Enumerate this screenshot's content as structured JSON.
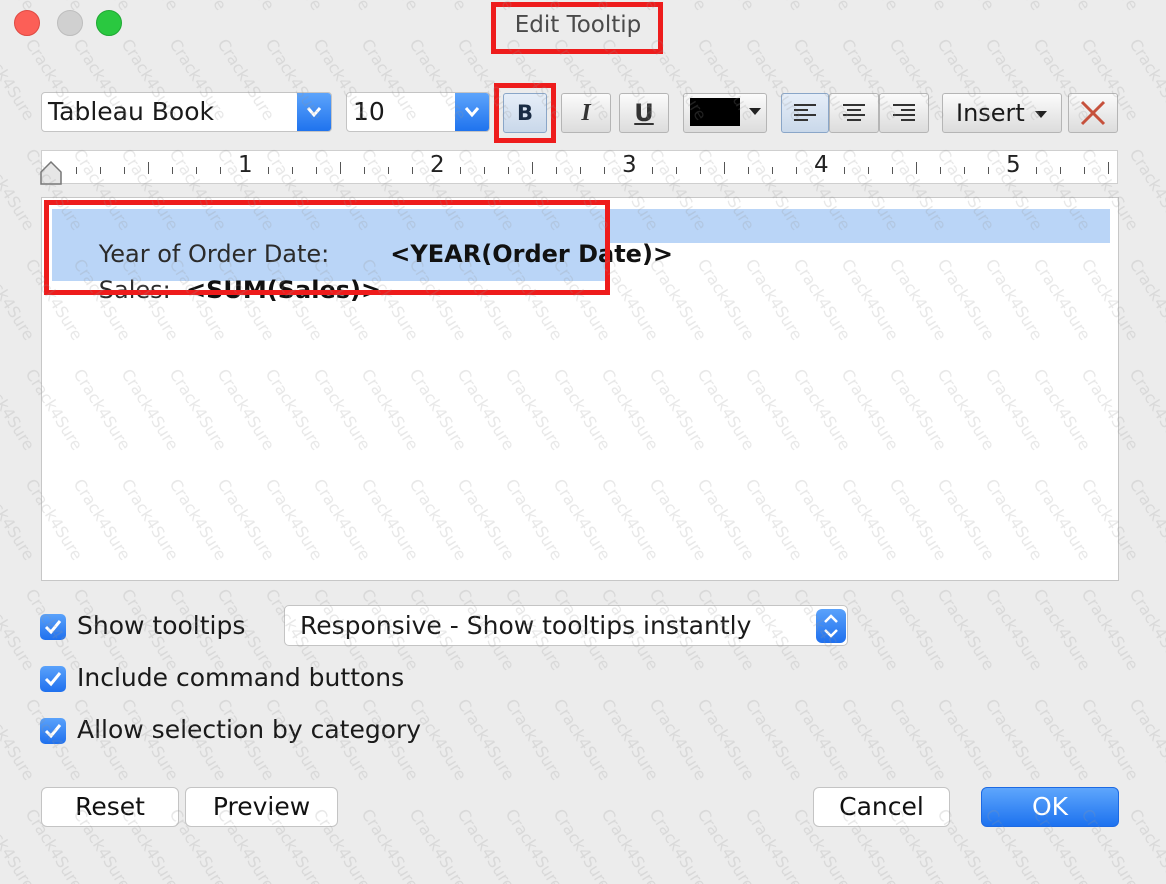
{
  "window": {
    "title": "Edit Tooltip"
  },
  "toolbar": {
    "font_name": "Tableau Book",
    "font_size": "10",
    "bold_label": "B",
    "italic_label": "I",
    "underline_label": "U",
    "text_color": "#000000",
    "insert_label": "Insert",
    "active_alignment": "left"
  },
  "ruler": {
    "labels": [
      "1",
      "2",
      "3",
      "4",
      "5"
    ]
  },
  "editor": {
    "line1_label": "Year of Order Date:",
    "line1_field": "<YEAR(Order Date)>",
    "line2_label": "Sales:",
    "line2_field": "<SUM(Sales)>"
  },
  "options": {
    "show_tooltips_label": "Show tooltips",
    "show_tooltips_checked": true,
    "tooltip_mode_value": "Responsive - Show tooltips instantly",
    "include_buttons_label": "Include command buttons",
    "include_buttons_checked": true,
    "allow_selection_label": "Allow selection by category",
    "allow_selection_checked": true
  },
  "buttons": {
    "reset": "Reset",
    "preview": "Preview",
    "cancel": "Cancel",
    "ok": "OK"
  },
  "watermark": "Crack4Sure",
  "colors": {
    "highlight": "#ee1c1c",
    "accent": "#1f73ee",
    "selection": "#bad5f7"
  }
}
